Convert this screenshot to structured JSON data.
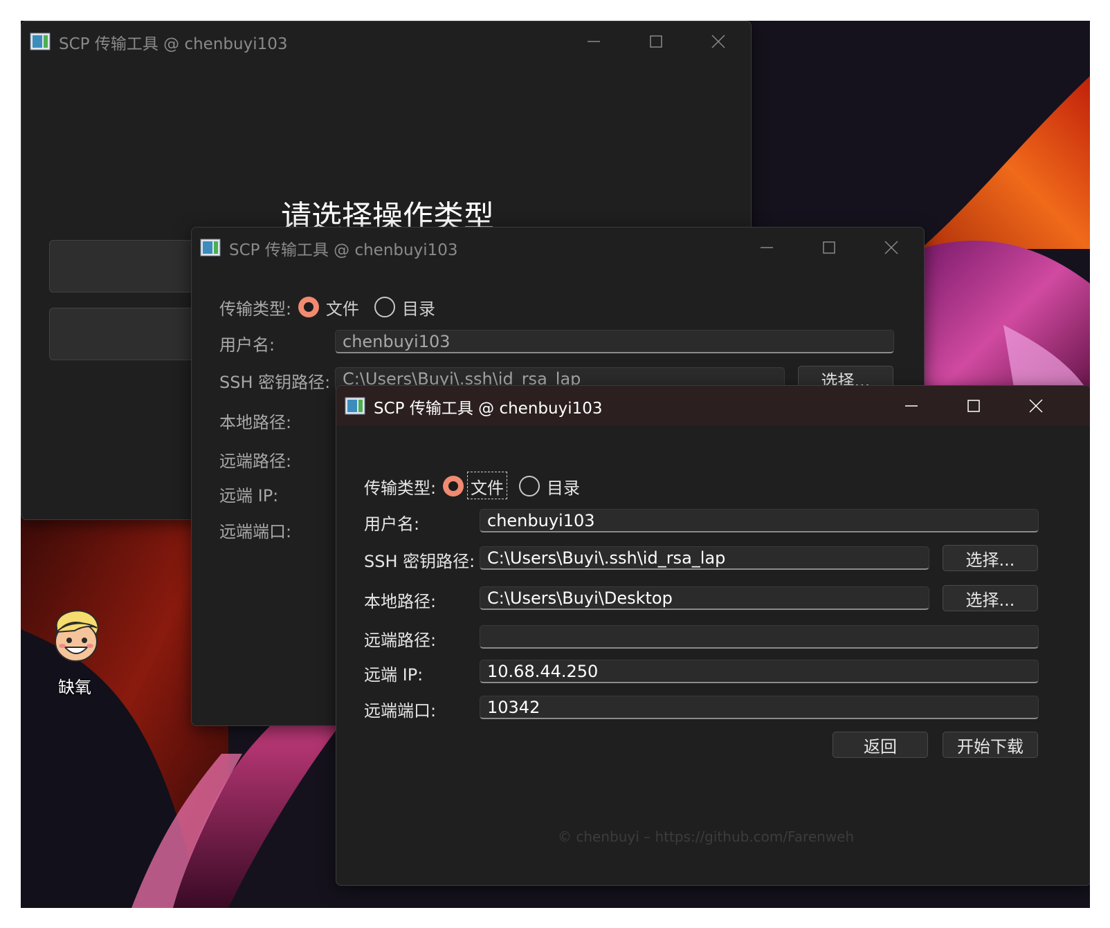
{
  "desktop": {
    "icon_name": "cartoon-avatar-icon",
    "icon_label": "缺氧"
  },
  "window_back": {
    "title": "SCP 传输工具 @ chenbuyi103",
    "heading": "请选择操作类型"
  },
  "window_mid": {
    "title": "SCP 传输工具 @ chenbuyi103",
    "transfer_type_label": "传输类型:",
    "radio_file": "文件",
    "radio_dir": "目录",
    "username_label": "用户名:",
    "username_value": "chenbuyi103",
    "ssh_label": "SSH 密钥路径:",
    "ssh_value": "C:\\Users\\Buyi\\.ssh\\id_rsa_lap",
    "choose_label": "选择...",
    "local_label": "本地路径:",
    "remote_path_label": "远端路径:",
    "remote_ip_label": "远端 IP:",
    "remote_port_label": "远端端口:"
  },
  "window_front": {
    "title": "SCP 传输工具 @ chenbuyi103",
    "transfer_type_label": "传输类型:",
    "radio_file": "文件",
    "radio_dir": "目录",
    "selected_type": "文件",
    "username_label": "用户名:",
    "username_value": "chenbuyi103",
    "ssh_label": "SSH 密钥路径:",
    "ssh_value": "C:\\Users\\Buyi\\.ssh\\id_rsa_lap",
    "ssh_choose": "选择...",
    "local_label": "本地路径:",
    "local_value": "C:\\Users\\Buyi\\Desktop",
    "local_choose": "选择...",
    "remote_path_label": "远端路径:",
    "remote_path_value": "",
    "remote_ip_label": "远端 IP:",
    "remote_ip_value": "10.68.44.250",
    "remote_port_label": "远端端口:",
    "remote_port_value": "10342",
    "back_button": "返回",
    "start_button": "开始下载",
    "footer": "© chenbuyi  –  https://github.com/Farenweh"
  },
  "colors": {
    "accent_radio": "#f08a71",
    "window_bg": "#1f1f1f",
    "active_titlebar": "#2b1f1f"
  }
}
